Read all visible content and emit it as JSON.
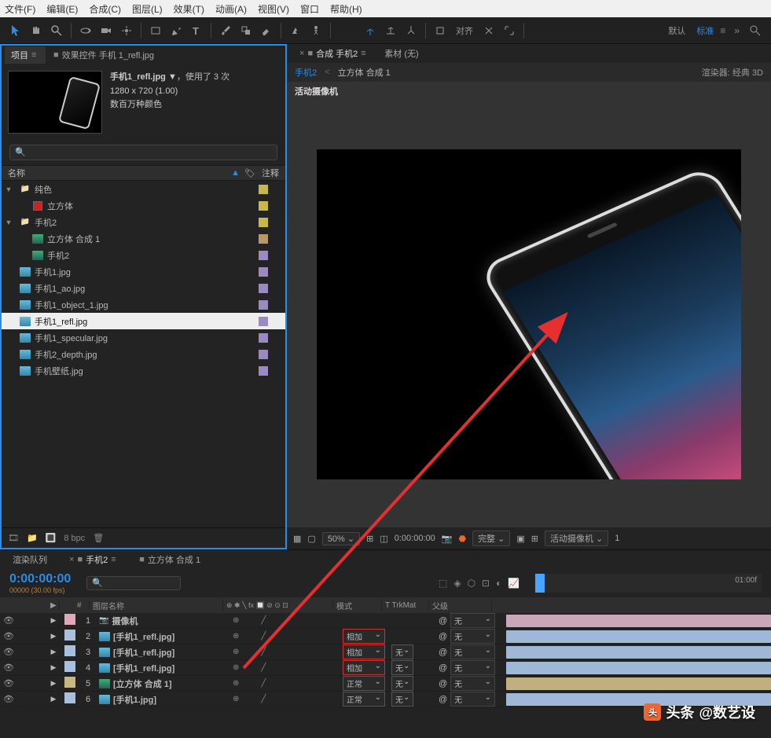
{
  "menu": [
    "文件(F)",
    "编辑(E)",
    "合成(C)",
    "图层(L)",
    "效果(T)",
    "动画(A)",
    "视图(V)",
    "窗口",
    "帮助(H)"
  ],
  "toolbar": {
    "align": "对齐",
    "default": "默认",
    "standard": "标准"
  },
  "projectPanel": {
    "tabs": {
      "project": "项目",
      "fx": "效果控件 手机 1_refl.jpg"
    },
    "asset": {
      "name": "手机1_refl.jpg ▼",
      "used": "，使用了 3 次",
      "dims": "1280 x 720 (1.00)",
      "colors": "数百万种颜色"
    },
    "searchPlaceholder": "🔍",
    "cols": {
      "name": "名称",
      "comment": "注释"
    },
    "items": [
      {
        "type": "folder",
        "label": "纯色",
        "indent": 0,
        "tw": "▼",
        "tag": "#c7b84a"
      },
      {
        "type": "solid",
        "label": "立方体",
        "indent": 1,
        "tag": "#c7b84a",
        "swatch": "#cc2222"
      },
      {
        "type": "folder",
        "label": "手机2",
        "indent": 0,
        "tw": "▼",
        "tag": "#c7b84a"
      },
      {
        "type": "comp",
        "label": "立方体 合成 1",
        "indent": 1,
        "tag": "#b89a6a"
      },
      {
        "type": "comp",
        "label": "手机2",
        "indent": 1,
        "tag": "#9a8ac0"
      },
      {
        "type": "img",
        "label": "手机1.jpg",
        "indent": 0,
        "tag": "#9a8ac0"
      },
      {
        "type": "img",
        "label": "手机1_ao.jpg",
        "indent": 0,
        "tag": "#9a8ac0"
      },
      {
        "type": "img",
        "label": "手机1_object_1.jpg",
        "indent": 0,
        "tag": "#9a8ac0"
      },
      {
        "type": "img",
        "label": "手机1_refl.jpg",
        "indent": 0,
        "tag": "#9a8ac0",
        "sel": true
      },
      {
        "type": "img",
        "label": "手机1_specular.jpg",
        "indent": 0,
        "tag": "#9a8ac0"
      },
      {
        "type": "img",
        "label": "手机2_depth.jpg",
        "indent": 0,
        "tag": "#9a8ac0"
      },
      {
        "type": "img",
        "label": "手机壁纸.jpg",
        "indent": 0,
        "tag": "#9a8ac0"
      }
    ],
    "footer": {
      "bpc": "8 bpc"
    }
  },
  "compPanel": {
    "tabs": {
      "comp": "合成 手机2",
      "footage": "素材 (无)"
    },
    "breadcrumb": {
      "a": "手机2",
      "b": "立方体 合成 1"
    },
    "renderer": "渲染器: 经典 3D",
    "camera": "活动摄像机",
    "footer": {
      "zoom": "50%",
      "time": "0:00:00:00",
      "res": "完整",
      "cam": "活动摄像机",
      "views": "1"
    }
  },
  "timeline": {
    "tabs": {
      "renderq": "渲染队列",
      "comp": "手机2",
      "comp2": "立方体 合成 1"
    },
    "timecode": "0:00:00:00",
    "fps": "00000 (30.00 fps)",
    "rulerEnd": "01:00f",
    "cols": {
      "num": "#",
      "name": "图层名称",
      "mode": "模式",
      "trkmat": "T  TrkMat",
      "parent": "父级"
    },
    "layers": [
      {
        "n": 1,
        "name": "摄像机",
        "type": "camera",
        "swatch": "#e0a8b8",
        "mode": "",
        "trkmat": "",
        "parent": "无",
        "bar": "#c8a8b8"
      },
      {
        "n": 2,
        "name": "[手机1_refl.jpg]",
        "type": "img",
        "swatch": "#a8c0e0",
        "mode": "相加",
        "hl": true,
        "trkmat": "",
        "parent": "无",
        "bar": "#a0b8d8"
      },
      {
        "n": 3,
        "name": "[手机1_refl.jpg]",
        "type": "img",
        "swatch": "#a8c0e0",
        "mode": "相加",
        "hl": true,
        "trkmat": "无",
        "parent": "无",
        "bar": "#a0b8d8"
      },
      {
        "n": 4,
        "name": "[手机1_refl.jpg]",
        "type": "img",
        "swatch": "#a8c0e0",
        "mode": "相加",
        "hl": true,
        "trkmat": "无",
        "parent": "无",
        "bar": "#a0b8d8"
      },
      {
        "n": 5,
        "name": "[立方体 合成 1]",
        "type": "comp",
        "swatch": "#c8b880",
        "mode": "正常",
        "trkmat": "无",
        "parent": "无",
        "bar": "#c0b080"
      },
      {
        "n": 6,
        "name": "[手机1.jpg]",
        "type": "img",
        "swatch": "#a8c0e0",
        "mode": "正常",
        "trkmat": "无",
        "parent": "无",
        "bar": "#a0b8d8"
      }
    ]
  },
  "watermark": {
    "prefix": "头条",
    "handle": "@数艺设"
  }
}
